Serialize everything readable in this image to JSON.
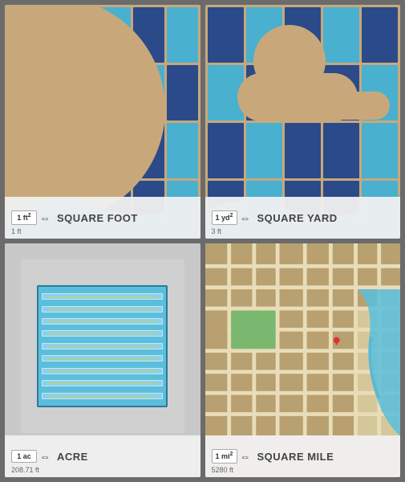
{
  "cards": [
    {
      "id": "square-foot",
      "label": "SQUARE FOOT",
      "unit": "1 ft²",
      "sub_label": "1 ft",
      "accent_color": "#2a4a8a",
      "light_color": "#4ab0d0"
    },
    {
      "id": "square-yard",
      "label": "SQUARE YARD",
      "unit": "1 yd²",
      "sub_label": "3 ft",
      "accent_color": "#2a4a8a",
      "light_color": "#4ab0d0"
    },
    {
      "id": "acre",
      "label": "ACRE",
      "unit": "1 ac",
      "sub_label": "208.71 ft",
      "accent_color": "#5bbedd"
    },
    {
      "id": "square-mile",
      "label": "SQUARE MILE",
      "unit": "1 mi²",
      "sub_label": "5280 ft",
      "accent_color": "#2a4a8a"
    }
  ],
  "icons": {
    "resize_arrows": "⇔"
  }
}
